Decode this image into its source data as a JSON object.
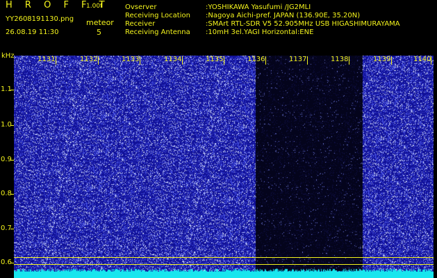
{
  "header": {
    "brand": "H R O F F T",
    "version": "1.00f",
    "filename": "YY2608191130.png",
    "datetime": "26.08.19 11:30",
    "mode": "meteor",
    "count": "5"
  },
  "meta": [
    {
      "key": "Ovserver",
      "value": ":YOSHIKAWA Yasufumi /JG2MLI"
    },
    {
      "key": "Receiving Location",
      "value": ":Nagoya Aichi-pref. JAPAN (136.90E, 35.20N)"
    },
    {
      "key": "Receiver",
      "value": ":SMArt RTL-SDR V5 52.905MHz USB HIGASHIMURAYAMA"
    },
    {
      "key": "Receiving Antenna",
      "value": ":10mH 3el.YAGI Horizontal:ENE"
    }
  ],
  "y_axis": {
    "unit": "kHz",
    "ticks": [
      "1.1",
      "1.0",
      "0.9",
      "0.8",
      "0.7",
      "0.6"
    ]
  },
  "x_axis": {
    "ticks": [
      "1131",
      "1132",
      "1133",
      "1134",
      "1135",
      "1136",
      "1137",
      "1138",
      "1139",
      "1140"
    ]
  },
  "colors": {
    "text": "#f4f41c",
    "waterfall_bg": "#10109a",
    "dark_band": "#04041c",
    "baseline": "#18e6ee"
  }
}
